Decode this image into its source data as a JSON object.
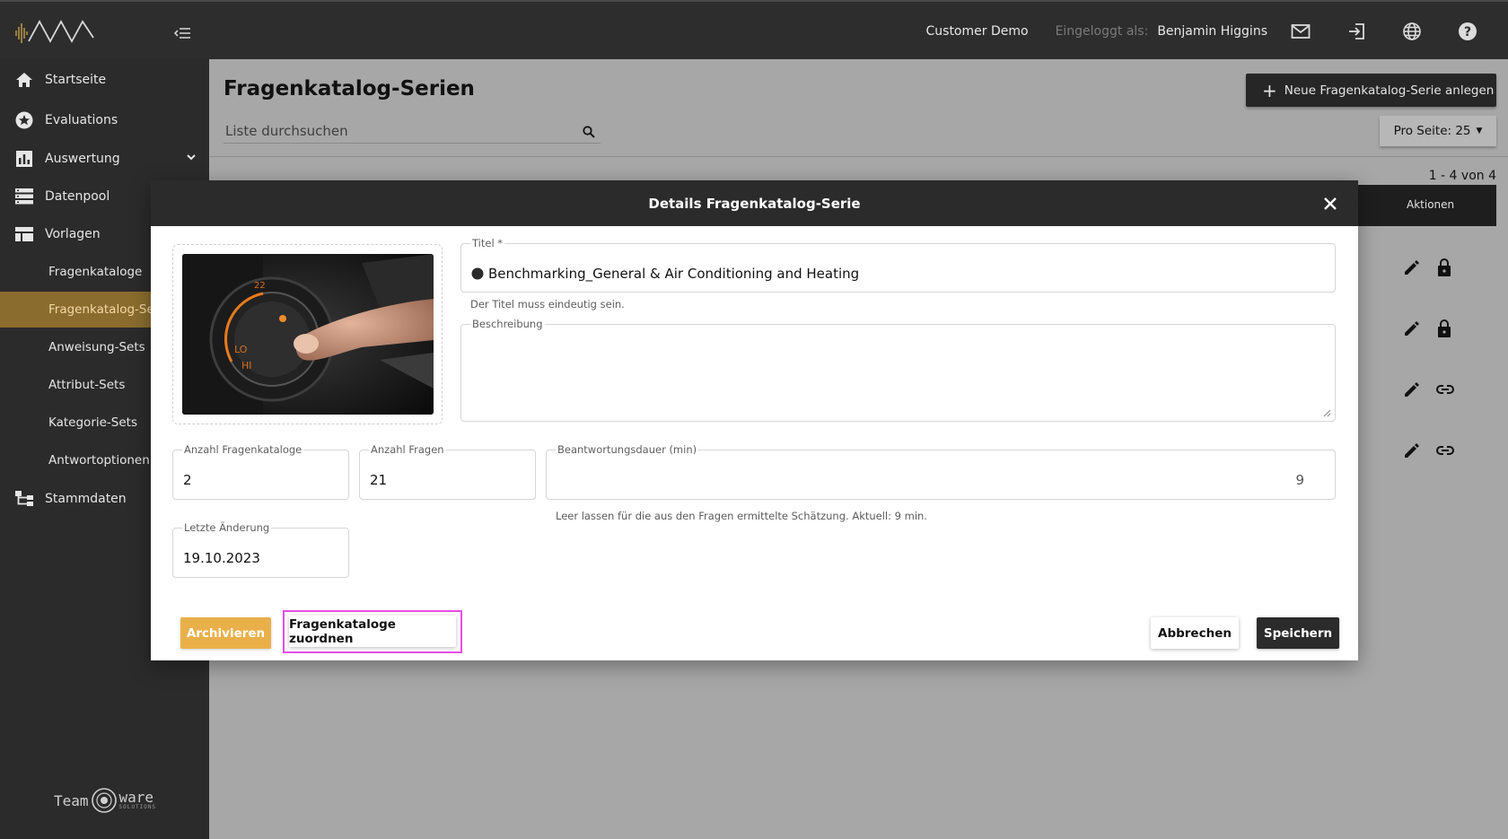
{
  "topbar": {
    "tenant": "Customer Demo",
    "login_label": "Eingeloggt als:",
    "user_name": "Benjamin Higgins",
    "icons": [
      "mail-icon",
      "logout-icon",
      "globe-icon",
      "help-icon"
    ]
  },
  "sidebar": {
    "items": [
      {
        "label": "Startseite",
        "icon": "home-icon"
      },
      {
        "label": "Evaluations",
        "icon": "star-icon"
      },
      {
        "label": "Auswertung",
        "icon": "bar-chart-icon"
      },
      {
        "label": "Datenpool",
        "icon": "database-icon"
      },
      {
        "label": "Vorlagen",
        "icon": "template-icon"
      },
      {
        "label": "Fragenkataloge"
      },
      {
        "label": "Fragenkatalog-Serien"
      },
      {
        "label": "Anweisung-Sets"
      },
      {
        "label": "Attribut-Sets"
      },
      {
        "label": "Kategorie-Sets"
      },
      {
        "label": "Antwortoptionen"
      },
      {
        "label": "Stammdaten",
        "icon": "hierarchy-icon"
      }
    ],
    "footer_left": "Team",
    "footer_right": "ware",
    "footer_small": "SOLUTIONS"
  },
  "main": {
    "title": "Fragenkatalog-Serien",
    "new_button": "Neue Fragenkatalog-Serie anlegen",
    "search_placeholder": "Liste durchsuchen",
    "per_page": "Pro Seite: 25",
    "paging_info": "1 - 4 von 4",
    "col_actions": "Aktionen"
  },
  "modal": {
    "title": "Details Fragenkatalog-Serie",
    "title_label": "Titel *",
    "title_value": "Benchmarking_General & Air Conditioning and Heating",
    "title_hint": "Der Titel muss eindeutig sein.",
    "description_label": "Beschreibung",
    "description_value": "",
    "count_catalogs_label": "Anzahl Fragenkataloge",
    "count_catalogs_value": "2",
    "count_questions_label": "Anzahl Fragen",
    "count_questions_value": "21",
    "duration_label": "Beantwortungsdauer (min)",
    "duration_value": "9",
    "duration_hint": "Leer lassen für die aus den Fragen ermittelte Schätzung. Aktuell: 9 min.",
    "last_change_label": "Letzte Änderung",
    "last_change_value": "19.10.2023",
    "archive_button": "Archivieren",
    "assign_button": "Fragenkataloge zuordnen",
    "cancel_button": "Abbrechen",
    "save_button": "Speichern"
  },
  "colors": {
    "accent": "#e9b04a",
    "dark": "#2b2b2b",
    "highlight": "#e64ee6"
  }
}
